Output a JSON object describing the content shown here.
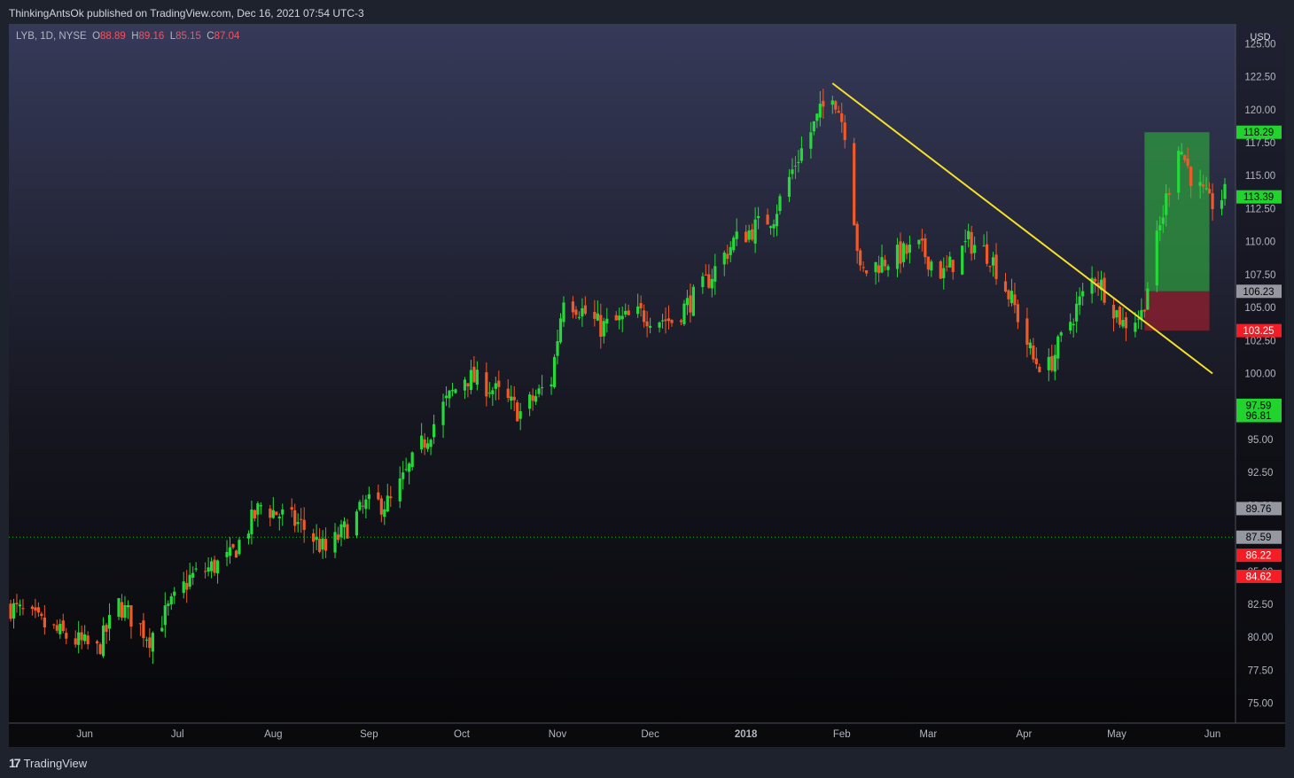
{
  "header": {
    "published_by": "ThinkingAntsOk published on TradingView.com, Dec 16, 2021 07:54 UTC-3"
  },
  "legend": {
    "symbol": "LYB, 1D, NYSE",
    "o_label": "O",
    "o": "88.89",
    "h_label": "H",
    "h": "89.16",
    "l_label": "L",
    "l": "85.15",
    "c_label": "C",
    "c": "87.04"
  },
  "footer": {
    "brand": "TradingView"
  },
  "colors": {
    "up": "#26d93a",
    "down": "#f05a28",
    "trendline": "#f5e02a",
    "target_zone": "#2e9e3e",
    "stop_zone": "#8c1f2e"
  },
  "chart_data": {
    "type": "candlestick",
    "symbol": "LYB",
    "interval": "1D",
    "exchange": "NYSE",
    "currency": "USD",
    "ylim": [
      73.5,
      126.5
    ],
    "y_ticks": [
      75,
      77.5,
      80,
      82.5,
      85,
      87.5,
      90,
      92.5,
      95,
      97.5,
      100,
      102.5,
      105,
      107.5,
      110,
      112.5,
      115,
      117.5,
      120,
      122.5,
      125
    ],
    "x_labels": [
      {
        "label": "Jun",
        "date": "2017-06-01"
      },
      {
        "label": "Jul",
        "date": "2017-07-01"
      },
      {
        "label": "Aug",
        "date": "2017-08-01"
      },
      {
        "label": "Sep",
        "date": "2017-09-01"
      },
      {
        "label": "Oct",
        "date": "2017-10-01"
      },
      {
        "label": "Nov",
        "date": "2017-11-01"
      },
      {
        "label": "Dec",
        "date": "2017-12-01"
      },
      {
        "label": "2018",
        "date": "2018-01-01",
        "bold": true
      },
      {
        "label": "Feb",
        "date": "2018-02-01"
      },
      {
        "label": "Mar",
        "date": "2018-03-01"
      },
      {
        "label": "Apr",
        "date": "2018-04-01"
      },
      {
        "label": "May",
        "date": "2018-05-01"
      },
      {
        "label": "Jun",
        "date": "2018-06-01"
      }
    ],
    "date_range": [
      "2017-05-08",
      "2018-06-05"
    ],
    "keypoints": [
      {
        "date": "2017-05-08",
        "close": 82.3
      },
      {
        "date": "2017-05-22",
        "close": 80.5
      },
      {
        "date": "2017-06-05",
        "close": 79.0
      },
      {
        "date": "2017-06-12",
        "close": 82.5
      },
      {
        "date": "2017-06-22",
        "close": 80.0
      },
      {
        "date": "2017-07-05",
        "close": 84.5
      },
      {
        "date": "2017-07-18",
        "close": 86.0
      },
      {
        "date": "2017-07-28",
        "close": 90.0
      },
      {
        "date": "2017-08-10",
        "close": 88.5
      },
      {
        "date": "2017-08-18",
        "close": 86.5
      },
      {
        "date": "2017-08-31",
        "close": 90.0
      },
      {
        "date": "2017-09-08",
        "close": 90.2
      },
      {
        "date": "2017-09-25",
        "close": 97.5
      },
      {
        "date": "2017-10-02",
        "close": 99.8
      },
      {
        "date": "2017-10-10",
        "close": 99.0
      },
      {
        "date": "2017-10-20",
        "close": 97.0
      },
      {
        "date": "2017-10-30",
        "close": 99.5
      },
      {
        "date": "2017-11-03",
        "close": 106.0
      },
      {
        "date": "2017-11-15",
        "close": 103.5
      },
      {
        "date": "2017-11-28",
        "close": 104.5
      },
      {
        "date": "2017-12-08",
        "close": 104.0
      },
      {
        "date": "2017-12-18",
        "close": 106.5
      },
      {
        "date": "2017-12-28",
        "close": 110.0
      },
      {
        "date": "2018-01-10",
        "close": 112.0
      },
      {
        "date": "2018-01-18",
        "close": 116.5
      },
      {
        "date": "2018-01-29",
        "close": 121.5
      },
      {
        "date": "2018-02-02",
        "close": 118.5
      },
      {
        "date": "2018-02-07",
        "close": 107.5
      },
      {
        "date": "2018-02-14",
        "close": 108.5
      },
      {
        "date": "2018-02-26",
        "close": 109.5
      },
      {
        "date": "2018-03-06",
        "close": 107.5
      },
      {
        "date": "2018-03-14",
        "close": 110.0
      },
      {
        "date": "2018-03-21",
        "close": 109.0
      },
      {
        "date": "2018-03-29",
        "close": 105.0
      },
      {
        "date": "2018-04-04",
        "close": 101.0
      },
      {
        "date": "2018-04-09",
        "close": 100.5
      },
      {
        "date": "2018-04-18",
        "close": 105.0
      },
      {
        "date": "2018-04-24",
        "close": 107.5
      },
      {
        "date": "2018-05-03",
        "close": 103.8
      },
      {
        "date": "2018-05-09",
        "close": 104.5
      },
      {
        "date": "2018-05-14",
        "close": 110.0
      },
      {
        "date": "2018-05-21",
        "close": 117.5
      },
      {
        "date": "2018-05-25",
        "close": 115.0
      },
      {
        "date": "2018-05-31",
        "close": 112.8
      },
      {
        "date": "2018-06-05",
        "close": 113.5
      }
    ],
    "price_labels": [
      {
        "value": 118.29,
        "text": "118.29",
        "style": "green"
      },
      {
        "value": 113.39,
        "text": "113.39",
        "style": "green"
      },
      {
        "value": 106.23,
        "text": "106.23",
        "style": "gray"
      },
      {
        "value": 103.25,
        "text": "103.25",
        "style": "red"
      },
      {
        "value": 97.59,
        "text": "97.59",
        "style": "green"
      },
      {
        "value": 96.81,
        "text": "96.81",
        "style": "green"
      },
      {
        "value": 89.76,
        "text": "89.76",
        "style": "gray"
      },
      {
        "value": 87.59,
        "text": "87.59",
        "style": "gray"
      },
      {
        "value": 86.22,
        "text": "86.22",
        "style": "red"
      },
      {
        "value": 84.62,
        "text": "84.62",
        "style": "red"
      }
    ],
    "current_price_line": 87.59,
    "trendline": {
      "start": {
        "date": "2018-01-29",
        "value": 122.0
      },
      "end": {
        "date": "2018-06-01",
        "value": 100.0
      }
    },
    "long_position": {
      "start": "2018-05-10",
      "end": "2018-05-31",
      "entry": 106.23,
      "target": 118.29,
      "stop": 103.25
    }
  }
}
